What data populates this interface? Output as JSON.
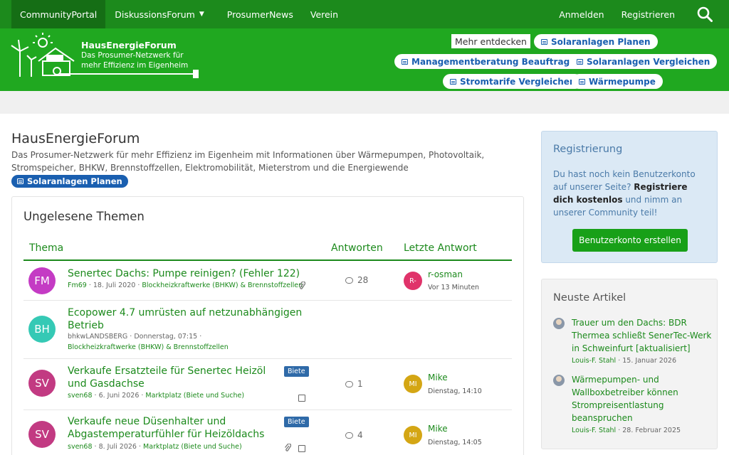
{
  "topnav": {
    "items": [
      "CommunityPortal",
      "DiskussionsForum",
      "ProsumerNews",
      "Verein"
    ],
    "login": "Anmelden",
    "register": "Registrieren"
  },
  "brand": {
    "title": "HausEnergieForum",
    "subtitle": "Das Prosumer-Netzwerk für mehr Effizienz im Eigenheim"
  },
  "tags": {
    "mehr": "Mehr entdecken",
    "items": [
      "Solaranlagen Planen",
      "Managementberatung Beauftragen",
      "Solaranlagen Vergleichen",
      "Stromtarife Vergleichen",
      "Wärmepumpe"
    ]
  },
  "page": {
    "title": "HausEnergieForum",
    "description": "Das Prosumer-Netzwerk für mehr Effizienz im Eigenheim mit Informationen über Wärmepumpen, Photovoltaik, Stromspeicher, BHKW, Brennstoffzellen, Elektromobilität, Mieterstrom und die Energiewende",
    "inline_tag": "Solaranlagen Planen"
  },
  "threads": {
    "title": "Ungelesene Themen",
    "col_topic": "Thema",
    "col_replies": "Antworten",
    "col_last": "Letzte Antwort",
    "rows": [
      {
        "initials": "FM",
        "color": "#c43bc4",
        "title": "Senertec Dachs: Pumpe reinigen? (Fehler 122)",
        "author": "Fm69",
        "date": "18. Juli 2020",
        "forum": "Blockheizkraftwerke (BHKW) & Brennstoffzellen",
        "replies": "28",
        "last_initials": "R-",
        "last_color": "#e0336a",
        "last_user": "r-osman",
        "last_time": "Vor 13 Minuten"
      },
      {
        "initials": "BH",
        "color": "#35c9b5",
        "title": "Ecopower 4.7 umrüsten auf netzunabhängigen Betrieb",
        "author": "bhkwLANDSBERG",
        "date": "Donnerstag, 07:15",
        "forum": "Blockheizkraftwerke (BHKW) & Brennstoffzellen"
      },
      {
        "initials": "SV",
        "color": "#c23a82",
        "title": "Verkaufe Ersatzteile für Senertec Heizöl und Gasdachse",
        "badge": "Biete",
        "author": "sven68",
        "date": "6. Juni 2026",
        "forum": "Marktplatz (Biete und Suche)",
        "replies": "1",
        "last_initials": "MI",
        "last_color": "#d4a614",
        "last_user": "Mike",
        "last_time": "Dienstag, 14:10"
      },
      {
        "initials": "SV",
        "color": "#c23a82",
        "title": "Verkaufe neue Düsenhalter und Abgastemperaturfühler für Heizöldachs",
        "badge": "Biete",
        "author": "sven68",
        "date": "8. Juli 2026",
        "forum": "Marktplatz (Biete und Suche)",
        "replies": "4",
        "last_initials": "MI",
        "last_color": "#d4a614",
        "last_user": "Mike",
        "last_time": "Dienstag, 14:05"
      }
    ]
  },
  "sidebar": {
    "reg_title": "Registrierung",
    "reg_text_1": "Du hast noch kein Benutzerkonto auf unserer Seite?",
    "reg_text_bold": "Registriere dich kostenlos",
    "reg_text_2": "und nimm an unserer Community teil!",
    "reg_button": "Benutzerkonto erstellen",
    "articles_title": "Neuste Artikel",
    "articles": [
      {
        "title": "Trauer um den Dachs: BDR Thermea schließt SenerTec-Werk in Schweinfurt [aktualisiert]",
        "author": "Louis-F. Stahl",
        "date": "15. Januar 2026"
      },
      {
        "title": "Wärmepumpen- und Wallboxbetreiber können Strompreisentlastung beanspruchen",
        "author": "Louis-F. Stahl",
        "date": "28. Februar 2025"
      }
    ]
  }
}
